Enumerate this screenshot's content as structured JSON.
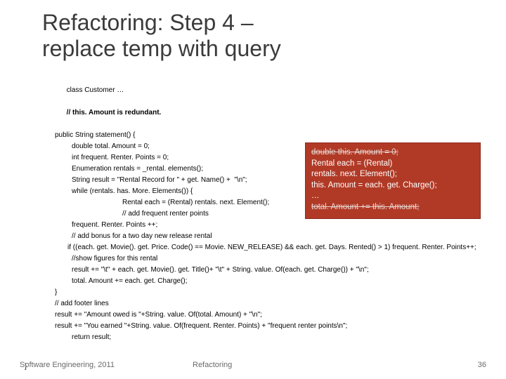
{
  "title": "Refactoring: Step 4 –\nreplace temp with query",
  "classLine": "class Customer …",
  "redundantComment": "// this. Amount is redundant.",
  "code": {
    "l1": "public String statement() {",
    "l2": "double total. Amount = 0;",
    "l3": "int frequent. Renter. Points = 0;",
    "l4": "Enumeration rentals = _rental. elements();",
    "l5": "String result = \"Rental Record for \" + get. Name() +  \"\\n\";",
    "l6": "while (rentals. has. More. Elements()) {",
    "l7": "Rental each = (Rental) rentals. next. Element();",
    "l8": "// add frequent renter points",
    "l9": "frequent. Renter. Points ++;",
    "l10": "// add bonus for a two day new release rental",
    "l11": "if ((each. get. Movie(). get. Price. Code() == Movie. NEW_RELEASE) &&   each. get. Days. Rented() > 1) frequent. Renter. Points++;",
    "l12": "//show figures for this rental",
    "l13": "result += \"\\t\" + each. get. Movie(). get. Title()+ \"\\t\" + String. value. Of(each. get. Charge()) + \"\\n\";",
    "l14": "total. Amount += each. get. Charge();",
    "l15": "}",
    "l16": "// add footer lines",
    "l17": "result += \"Amount owed is \"+String. value. Of(total. Amount) + \"\\n\";",
    "l18": "result += \"You earned \"+String. value. Of(frequent. Renter. Points) + \"frequent renter points\\n\";",
    "l19": "return result;"
  },
  "braceNote": "}",
  "callout": {
    "l1": "double this. Amount  = 0;",
    "l2a": "Rental each = (Rental)",
    "l2b": "rentals. next. Element();",
    "l3": "this. Amount = each. get. Charge();",
    "l4": "…",
    "l5": "total. Amount += this. Amount;"
  },
  "footer": {
    "left": "Software Engineering, 2011",
    "mid": "Refactoring",
    "right": "36"
  }
}
